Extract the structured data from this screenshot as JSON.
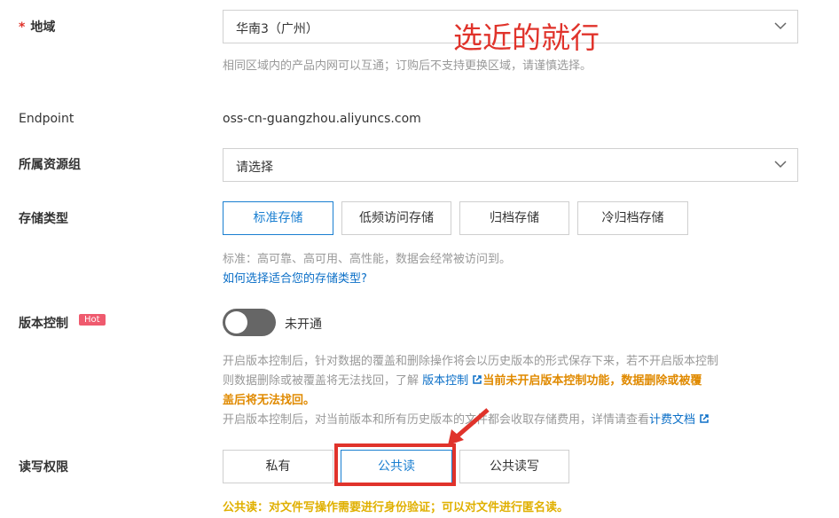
{
  "region": {
    "label": "地域",
    "required_mark": "*",
    "value": "华南3（广州）",
    "hint": "相同区域内的产品内网可以互通；订购后不支持更换区域，请谨慎选择。",
    "annotation": "选近的就行"
  },
  "endpoint": {
    "label": "Endpoint",
    "value": "oss-cn-guangzhou.aliyuncs.com"
  },
  "resource_group": {
    "label": "所属资源组",
    "placeholder": "请选择"
  },
  "storage_class": {
    "label": "存储类型",
    "options": [
      "标准存储",
      "低频访问存储",
      "归档存储",
      "冷归档存储"
    ],
    "selected": "标准存储",
    "hint": "标准：高可靠、高可用、高性能，数据会经常被访问到。",
    "help_link": "如何选择适合您的存储类型?"
  },
  "versioning": {
    "label": "版本控制",
    "badge": "Hot",
    "toggle_state": "未开通",
    "desc_line1": "开启版本控制后，针对数据的覆盖和删除操作将会以历史版本的形式保存下来，若不开启版本控制",
    "desc_line2_prefix": "则数据删除或被覆盖将无法找回，了解",
    "desc_link": "版本控制",
    "warn_part1": "当前未开启版本控制功能，数据删除或被覆",
    "warn_part2": "盖后将无法找回。",
    "desc_line4": "开启版本控制后，对当前版本和所有历史版本的文件都会收取存储费用，详情请查看",
    "fee_link": "计费文档"
  },
  "acl": {
    "label": "读写权限",
    "options": [
      "私有",
      "公共读",
      "公共读写"
    ],
    "selected": "公共读",
    "warning": "公共读：对文件写操作需要进行身份验证；可以对文件进行匿名读。"
  },
  "colors": {
    "accent": "#1a7fd1",
    "annotation_red": "#e0332b",
    "warning": "#e08a00"
  }
}
